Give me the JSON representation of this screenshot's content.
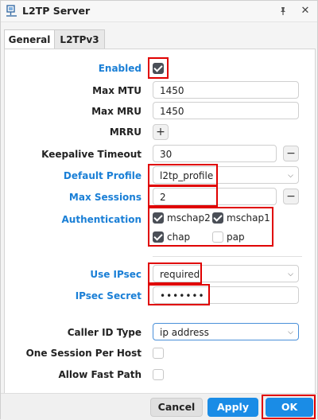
{
  "window": {
    "title": "L2TP Server",
    "pin_icon": "pin-icon",
    "close_icon": "close-icon"
  },
  "tabs": [
    {
      "label": "General",
      "active": true
    },
    {
      "label": "L2TPv3",
      "active": false
    }
  ],
  "fields": {
    "enabled": {
      "label": "Enabled",
      "checked": true
    },
    "max_mtu": {
      "label": "Max MTU",
      "value": "1450"
    },
    "max_mru": {
      "label": "Max MRU",
      "value": "1450"
    },
    "mrru": {
      "label": "MRRU",
      "add": "+"
    },
    "keepalive": {
      "label": "Keepalive Timeout",
      "value": "30",
      "remove": "−"
    },
    "default_profile": {
      "label": "Default Profile",
      "value": "l2tp_profile"
    },
    "max_sessions": {
      "label": "Max Sessions",
      "value": "2",
      "remove": "−"
    },
    "authentication": {
      "label": "Authentication",
      "options": [
        {
          "label": "mschap2",
          "checked": true
        },
        {
          "label": "mschap1",
          "checked": true
        },
        {
          "label": "chap",
          "checked": true
        },
        {
          "label": "pap",
          "checked": false
        }
      ]
    },
    "use_ipsec": {
      "label": "Use IPsec",
      "value": "required"
    },
    "ipsec_secret": {
      "label": "IPsec Secret",
      "value": "•••••••"
    },
    "caller_id_type": {
      "label": "Caller ID Type",
      "value": "ip address"
    },
    "one_session_per_host": {
      "label": "One Session Per Host",
      "checked": false
    },
    "allow_fast_path": {
      "label": "Allow Fast Path",
      "checked": false
    }
  },
  "footer": {
    "cancel": "Cancel",
    "apply": "Apply",
    "ok": "OK"
  },
  "colors": {
    "accent": "#1a8ce6",
    "label_blue": "#1a7fd6",
    "highlight": "#e00000"
  }
}
